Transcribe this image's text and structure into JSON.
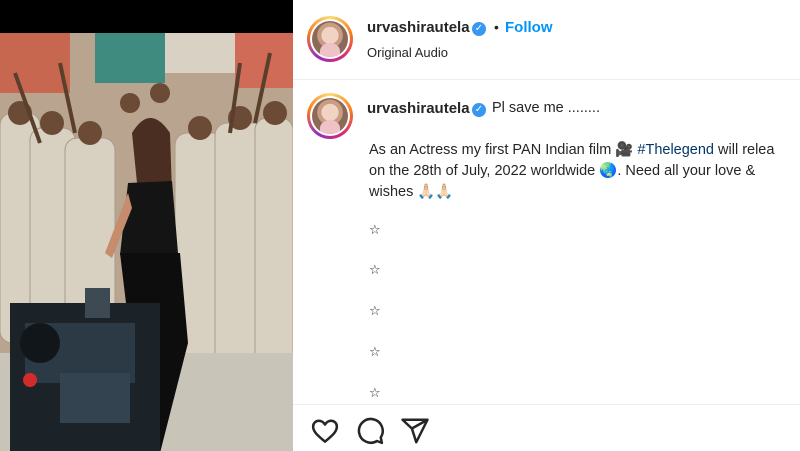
{
  "post": {
    "username": "urvashirautela",
    "verified_icon": "verified-badge-icon",
    "separator": "•",
    "follow_label": "Follow",
    "audio_label": "Original Audio"
  },
  "caption": {
    "username": "urvashirautela",
    "headline": "Pl save me ........",
    "line1_before": "As an Actress my first PAN Indian film ",
    "line1_emoji": "🎥",
    "line1_hashtag": "#Thelegend",
    "line1_after": " will relea",
    "line2_before": "on the 28th of July, 2022 worldwide ",
    "line2_emoji": "🌏",
    "line2_after": ". Need all your love &",
    "line3": "wishes 🙏🏻🙏🏻",
    "stars": [
      "☆",
      "☆",
      "☆",
      "☆",
      "☆"
    ]
  },
  "actions": {
    "like_icon": "heart-icon",
    "comment_icon": "comment-icon",
    "share_icon": "share-icon"
  },
  "colors": {
    "accent": "#0095f6",
    "hashtag": "#00376b",
    "verified": "#3897f0",
    "text": "#262626"
  }
}
